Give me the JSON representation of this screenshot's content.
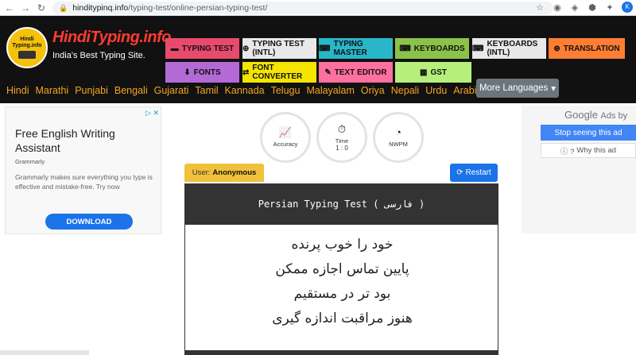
{
  "browser": {
    "url_domain": "hinditypinq.info",
    "url_path": "/typing-test/online-persian-typing-test/",
    "icons": [
      "back-icon",
      "forward-icon",
      "reload-icon",
      "lock-icon",
      "star-icon",
      "extension-icon",
      "profile-icon"
    ],
    "avatar_letter": "K"
  },
  "header": {
    "logo_text": "Hindi Typing.info",
    "title": "HindiTyping.info",
    "tagline": "India's Best Typing Site.",
    "tools": [
      {
        "label": "TYPING TEST",
        "color": "#e84a6f"
      },
      {
        "label": "TYPING TEST (INTL)",
        "color": "#e8e8e8"
      },
      {
        "label": "TYPING MASTER",
        "color": "#29b6c9"
      },
      {
        "label": "KEYBOARDS",
        "color": "#8bc34a"
      },
      {
        "label": "KEYBOARDS (INTL)",
        "color": "#e8e8e8"
      },
      {
        "label": "TRANSLATION",
        "color": "#ff7e33"
      },
      {
        "label": "FONTS",
        "color": "#b36ad6"
      },
      {
        "label": "FONT CONVERTER",
        "color": "#f5e400"
      },
      {
        "label": "TEXT EDITOR",
        "color": "#ff6fa0"
      },
      {
        "label": "GST",
        "color": "#b6f07c"
      }
    ],
    "languages": [
      "Hindi",
      "Marathi",
      "Punjabi",
      "Bengali",
      "Gujarati",
      "Tamil",
      "Kannada",
      "Telugu",
      "Malayalam",
      "Oriya",
      "Nepali",
      "Urdu",
      "Arabic"
    ],
    "more_languages": "More Languages"
  },
  "ad_left": {
    "title": "Free English Writing Assistant",
    "source": "Grammarly",
    "description": "Grammarly makes sure everything you type is effective and mistake-free. Try now",
    "cta": "DOWNLOAD"
  },
  "stats": {
    "accuracy_label": "Accuracy",
    "time_label": "Time",
    "time_value": "1 : 0",
    "nwpm_label": "NWPM"
  },
  "test": {
    "user_label": "User:",
    "user_name": "Anonymous",
    "restart_label": "Restart",
    "heading": "Persian Typing Test ( فارسی )",
    "lines": [
      "خود را خوب پرنده",
      "پایین تماس اجازه ممکن",
      "بود تر در مستقیم",
      "هنوز مراقبت اندازه گیری"
    ]
  },
  "ad_right": {
    "google": "Google",
    "ads_by": "Ads by",
    "stop": "Stop seeing this ad",
    "why": "Why this ad"
  }
}
